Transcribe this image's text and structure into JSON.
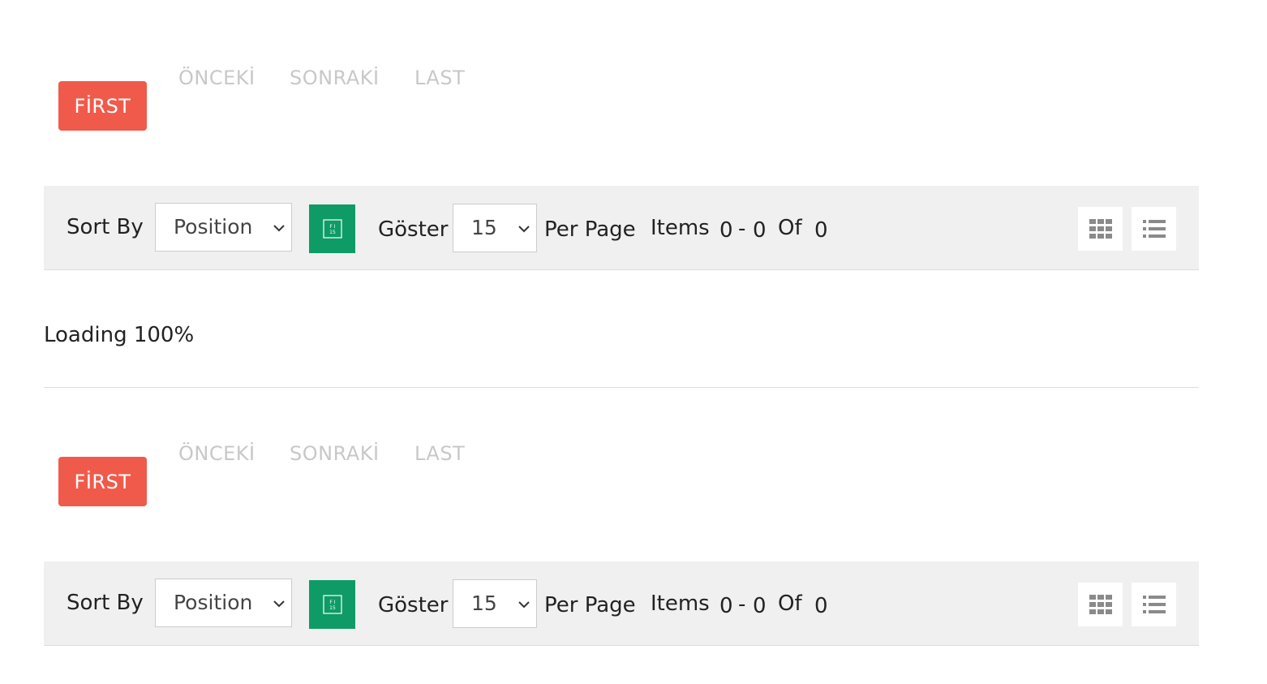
{
  "pagers": [
    {
      "first_label": "FİRST",
      "prev_label": "ÖNCEKİ",
      "next_label": "SONRAKİ",
      "last_label": "LAST"
    },
    {
      "first_label": "FİRST",
      "prev_label": "ÖNCEKİ",
      "next_label": "SONRAKİ",
      "last_label": "LAST"
    }
  ],
  "toolbars": [
    {
      "sort_by_label": "Sort By",
      "sort_value": "Position",
      "sort_direction_icon": "sort-direction-icon",
      "show_label": "Göster",
      "per_page_value": "15",
      "per_page_label": "Per Page",
      "items_label": "Items",
      "range_start": "0",
      "range_sep": "-",
      "range_end": "0",
      "of_label": "Of",
      "total": "0",
      "grid_icon": "grid-view-icon",
      "list_icon": "list-view-icon"
    },
    {
      "sort_by_label": "Sort By",
      "sort_value": "Position",
      "sort_direction_icon": "sort-direction-icon",
      "show_label": "Göster",
      "per_page_value": "15",
      "per_page_label": "Per Page",
      "items_label": "Items",
      "range_start": "0",
      "range_sep": "-",
      "range_end": "0",
      "of_label": "Of",
      "total": "0",
      "grid_icon": "grid-view-icon",
      "list_icon": "list-view-icon"
    }
  ],
  "loading_text": "Loading 100%",
  "colors": {
    "first_button_bg": "#f05a4b",
    "sort_direction_bg": "#0f9b66",
    "toolbar_bg": "#f0f0f0",
    "inactive_link": "#c8c8c8"
  }
}
